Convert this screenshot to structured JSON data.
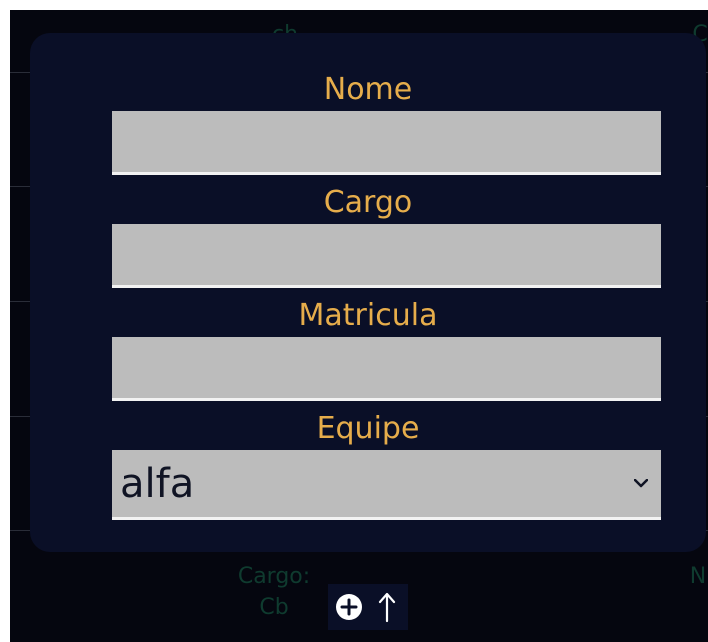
{
  "colors": {
    "page_background": "#05060f",
    "modal_background": "#0a0f27",
    "label": "#e6ad4b",
    "input_background": "#bcbcbc",
    "input_border": "#f2f2f2",
    "select_text": "#101424",
    "background_text": "#0f3b2f"
  },
  "background_table": {
    "top_text": "ch",
    "top_right_text": "C",
    "cargo_label": "Cargo:",
    "cargo_value": "Cb",
    "right_text_bottom": "N"
  },
  "form": {
    "fields": {
      "nome": {
        "label": "Nome",
        "value": "",
        "placeholder": ""
      },
      "cargo": {
        "label": "Cargo",
        "value": "",
        "placeholder": ""
      },
      "matricula": {
        "label": "Matricula",
        "value": "",
        "placeholder": ""
      }
    },
    "equipe": {
      "label": "Equipe",
      "selected": "alfa"
    }
  },
  "icons": {
    "add": "plus-circle-icon",
    "up": "arrow-up-icon",
    "dropdown": "chevron-down-icon"
  }
}
